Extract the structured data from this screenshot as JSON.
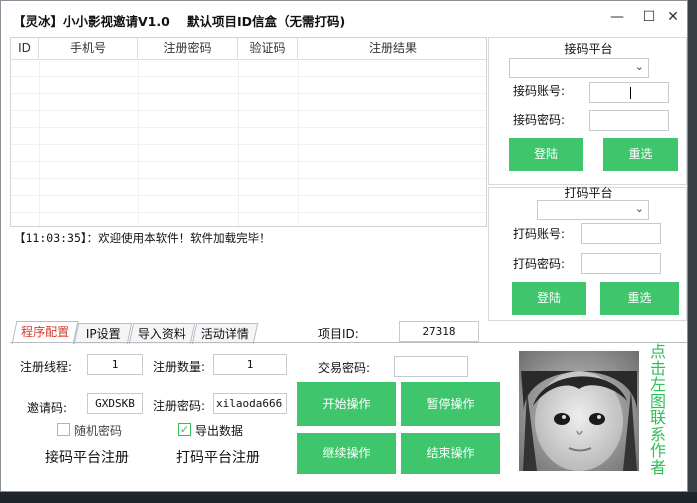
{
  "window": {
    "title": "【灵冰】小小影视邀请V1.0",
    "subtitle": "默认项目ID信盒（无需打码)",
    "minimize_glyph": "—",
    "maximize_glyph": "☐",
    "close_glyph": "✕"
  },
  "table": {
    "columns": [
      "ID",
      "手机号",
      "注册密码",
      "验证码",
      "注册结果"
    ],
    "rows": []
  },
  "log": {
    "line": "【11:03:35】：欢迎使用本软件！软件加载完毕！"
  },
  "sms_platform": {
    "title": "接码平台",
    "platform_select_value": "",
    "account_label": "接码账号:",
    "account_value": "",
    "password_label": "接码密码:",
    "password_value": "",
    "login_button": "登陆",
    "reset_button": "重选"
  },
  "captcha_platform": {
    "title": "打码平台",
    "platform_select_value": "",
    "account_label": "打码账号:",
    "account_value": "",
    "password_label": "打码密码:",
    "password_value": "",
    "login_button": "登陆",
    "reset_button": "重选"
  },
  "tabs": [
    {
      "label": "程序配置",
      "active": true
    },
    {
      "label": "IP设置",
      "active": false
    },
    {
      "label": "导入资料",
      "active": false
    },
    {
      "label": "活动详情",
      "active": false
    }
  ],
  "project": {
    "id_label": "项目ID:",
    "id_value": "27318"
  },
  "config": {
    "threads_label": "注册线程:",
    "threads_value": "1",
    "count_label": "注册数量:",
    "count_value": "1",
    "trade_pwd_label": "交易密码:",
    "trade_pwd_value": "",
    "invite_label": "邀请码:",
    "invite_value": "GXDSKB",
    "reg_pwd_label": "注册密码:",
    "reg_pwd_value": "xilaoda666",
    "random_pwd_label": "随机密码",
    "random_pwd_checked": false,
    "export_label": "导出数据",
    "export_checked": true,
    "sms_register_link": "接码平台注册",
    "captcha_register_link": "打码平台注册"
  },
  "actions": {
    "start": "开始操作",
    "pause": "暂停操作",
    "continue": "继续操作",
    "stop": "结束操作"
  },
  "contact": {
    "text": "点击左图联系作者"
  },
  "colors": {
    "green_button": "#3fc56c",
    "active_tab_text": "#d43a2c",
    "contact_text": "#2fbf55"
  }
}
